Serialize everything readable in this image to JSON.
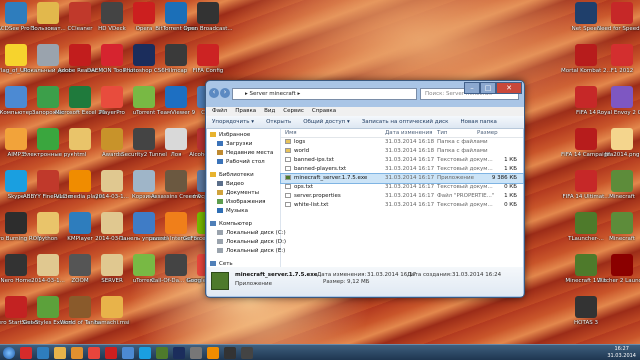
{
  "desktop": {
    "icons": [
      {
        "label": "ACDSee Pro 5",
        "color": "#2e7dbd"
      },
      {
        "label": "Пользоват...",
        "color": "#e2b84c"
      },
      {
        "label": "CCleaner",
        "color": "#c0392b"
      },
      {
        "label": "HD VDeck",
        "color": "#444"
      },
      {
        "label": "Opera",
        "color": "#cc1f1f"
      },
      {
        "label": "BitTorrent Sync",
        "color": "#1b6fb8"
      },
      {
        "label": "Open Broadcast...",
        "color": "#333"
      },
      {
        "label": "Flag_of_Ukr...",
        "color": "#f6d32d"
      },
      {
        "label": "Локальный диск (E)",
        "color": "#9aa3ad"
      },
      {
        "label": "Adobe Reader X",
        "color": "#c21d1d"
      },
      {
        "label": "DAEMON Tools Lite",
        "color": "#d6242f"
      },
      {
        "label": "Photoshop CS6",
        "color": "#1b2d5c"
      },
      {
        "label": "Hilmcap",
        "color": "#3a3a3a"
      },
      {
        "label": "FIFA Config",
        "color": "#cc2323"
      },
      {
        "label": "Компьютер",
        "color": "#4c8ad3"
      },
      {
        "label": "Запорожье",
        "color": "#3c9f4a"
      },
      {
        "label": "Microsoft Excel 2010",
        "color": "#1f7a3c"
      },
      {
        "label": "PlayerPro",
        "color": "#e84c3d"
      },
      {
        "label": "uTorrent",
        "color": "#78b944"
      },
      {
        "label": "ТеамViewer 9",
        "color": "#1d6fc2"
      },
      {
        "label": "Сеть",
        "color": "#4f7fb8"
      },
      {
        "label": "AIMP3",
        "color": "#f2a33a"
      },
      {
        "label": "Электронные руководств...",
        "color": "#3aa63e"
      },
      {
        "label": "html",
        "color": "#e9c46a"
      },
      {
        "label": "Awards",
        "color": "#c8932a"
      },
      {
        "label": "Security2 Tunnel",
        "color": "#444"
      },
      {
        "label": "Лоя",
        "color": "#d9d9d9"
      },
      {
        "label": "Alcohol 120%",
        "color": "#b83232"
      },
      {
        "label": "Skype",
        "color": "#1a9fe0"
      },
      {
        "label": "ABBYY FineReader 11",
        "color": "#c0392b"
      },
      {
        "label": "VLC media player",
        "color": "#f08c00"
      },
      {
        "label": "2014-03-1...",
        "color": "#e0c890"
      },
      {
        "label": "Корзина",
        "color": "#9fb5c8"
      },
      {
        "label": "Assassins Creed Re...",
        "color": "#6b5840"
      },
      {
        "label": "mvcp08.06",
        "color": "#5a78a0"
      },
      {
        "label": "Nero Burning ROM",
        "color": "#2d2d2d"
      },
      {
        "label": "python",
        "color": "#e9c46a"
      },
      {
        "label": "KMPlayer",
        "color": "#2e7dbd"
      },
      {
        "label": "2014-03-1...",
        "color": "#e0c890"
      },
      {
        "label": "Панель управления",
        "color": "#3f7cc6"
      },
      {
        "label": "avast! Internet Se...",
        "color": "#f07f1a"
      },
      {
        "label": "GeForce Experience",
        "color": "#76b900"
      },
      {
        "label": "Nero Home",
        "color": "#333"
      },
      {
        "label": "2014-03-1...",
        "color": "#e0c890"
      },
      {
        "label": "ZOOM",
        "color": "#555"
      },
      {
        "label": "SERVER",
        "color": "#e0c890"
      },
      {
        "label": "uTorrent",
        "color": "#78b944"
      },
      {
        "label": "Call-Of-Da... Games",
        "color": "#444"
      },
      {
        "label": "Google Chrome",
        "color": "#e8453c"
      },
      {
        "label": "Nero StartSmart",
        "color": "#c32222"
      },
      {
        "label": "Get-Styles Extreme...",
        "color": "#5ca13b"
      },
      {
        "label": "World of Tanks",
        "color": "#8a5a2b"
      },
      {
        "label": "hamachi.msi",
        "color": "#e8b34a"
      }
    ],
    "right_icons": [
      {
        "label": "Net Speed",
        "color": "#1f3f6b"
      },
      {
        "label": "Need for Speed World",
        "color": "#c62828"
      },
      {
        "label": "Mortal Kombat 2...",
        "color": "#b71c1c"
      },
      {
        "label": "F1 2012",
        "color": "#d32f2f"
      },
      {
        "label": "FIFA 14",
        "color": "#c62828"
      },
      {
        "label": "Royal Envoy 2 Collecto...",
        "color": "#7e57c2"
      },
      {
        "label": "FIFA 14 Campaign T...",
        "color": "#b71c1c"
      },
      {
        "label": "fifa2014.png",
        "color": "#f4d58d"
      },
      {
        "label": "FIFA 14 Ultimat...",
        "color": "#c62828"
      },
      {
        "label": "Minecraft",
        "color": "#5d8c3a"
      },
      {
        "label": "TLauncher-...",
        "color": "#4e7a2b"
      },
      {
        "label": "Minecraft",
        "color": "#5d8c3a"
      },
      {
        "label": "Minecraft 1.7.x",
        "color": "#4e7a2b"
      },
      {
        "label": "Witcher 2 Launcher",
        "color": "#8b0000"
      },
      {
        "label": "HOTAS 3",
        "color": "#333"
      }
    ]
  },
  "window": {
    "address_path": "▸ Server minecraft ▸",
    "search_placeholder": "Поиск: Server minecraft",
    "menu": [
      "Файл",
      "Правка",
      "Вид",
      "Сервис",
      "Справка"
    ],
    "toolbar": [
      "Упорядочить ▾",
      "Открыть",
      "Общий доступ ▾",
      "Записать на оптический диск",
      "Новая папка"
    ],
    "nav": [
      {
        "label": "Избранное",
        "color": "#e8b32e"
      },
      {
        "label": "Загрузки",
        "color": "#3b73b9"
      },
      {
        "label": "Недавние места",
        "color": "#c08a30"
      },
      {
        "label": "Рабочий стол",
        "color": "#3b73b9"
      },
      {
        "label": "",
        "color": ""
      },
      {
        "label": "Библиотеки",
        "color": "#e8b32e"
      },
      {
        "label": "Видео",
        "color": "#5a6e8a"
      },
      {
        "label": "Документы",
        "color": "#d1a33b"
      },
      {
        "label": "Изображения",
        "color": "#5d9d4e"
      },
      {
        "label": "Музыка",
        "color": "#2f6fb5"
      },
      {
        "label": "",
        "color": ""
      },
      {
        "label": "Компьютер",
        "color": "#4f7fb8"
      },
      {
        "label": "Локальный диск (C:)",
        "color": "#9aa3ad"
      },
      {
        "label": "Локальный диск (D:)",
        "color": "#9aa3ad"
      },
      {
        "label": "Локальный диск (E:)",
        "color": "#9aa3ad"
      },
      {
        "label": "",
        "color": ""
      },
      {
        "label": "Сеть",
        "color": "#4f7fb8"
      }
    ],
    "columns": [
      "Имя",
      "Дата изменения",
      "Тип",
      "Размер"
    ],
    "files": [
      {
        "name": "logs",
        "date": "31.03.2014 16:18",
        "type": "Папка с файлами",
        "size": "",
        "kind": "folder"
      },
      {
        "name": "world",
        "date": "31.03.2014 16:18",
        "type": "Папка с файлами",
        "size": "",
        "kind": "folder"
      },
      {
        "name": "banned-ips.txt",
        "date": "31.03.2014 16:17",
        "type": "Текстовый докум...",
        "size": "1 КБ",
        "kind": "file"
      },
      {
        "name": "banned-players.txt",
        "date": "31.03.2014 16:17",
        "type": "Текстовый докум...",
        "size": "1 КБ",
        "kind": "file"
      },
      {
        "name": "minecraft_server.1.7.5.exe",
        "date": "31.03.2014 16:17",
        "type": "Приложение",
        "size": "9 386 КБ",
        "kind": "exe"
      },
      {
        "name": "ops.txt",
        "date": "31.03.2014 16:17",
        "type": "Текстовый докум...",
        "size": "0 КБ",
        "kind": "file"
      },
      {
        "name": "server.properties",
        "date": "31.03.2014 16:17",
        "type": "Файл \"PROPERTIE...\"",
        "size": "1 КБ",
        "kind": "file"
      },
      {
        "name": "white-list.txt",
        "date": "31.03.2014 16:17",
        "type": "Текстовый докум...",
        "size": "0 КБ",
        "kind": "file"
      }
    ],
    "selected_index": 4,
    "details": {
      "name": "minecraft_server.1.7.5.exe",
      "type": "Приложение",
      "modified_label": "Дата изменения:",
      "modified": "31.03.2014 16:17",
      "created_label": "Дата создания:",
      "created": "31.03.2014 16:24",
      "size_label": "Размер:",
      "size": "9,12 МБ"
    }
  },
  "taskbar": {
    "time": "16:27",
    "date": "31.03.2014",
    "apps": [
      "yandex",
      "ie",
      "folder",
      "media",
      "chrome",
      "opera",
      "explorer",
      "skype",
      "minecraft",
      "ps",
      "calc",
      "wmp",
      "headset",
      "obs"
    ]
  }
}
